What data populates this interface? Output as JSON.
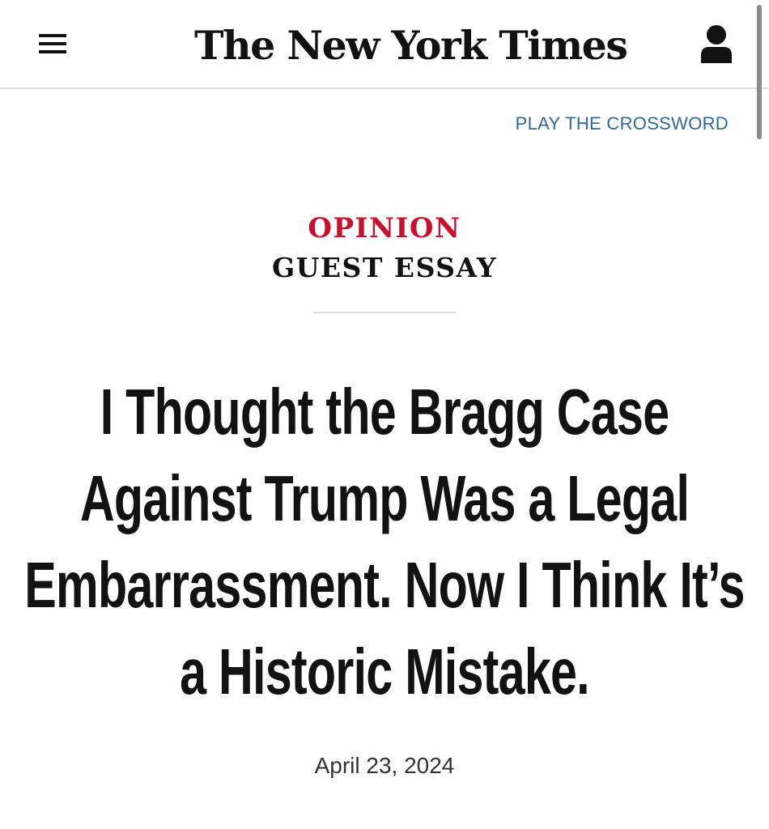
{
  "header": {
    "logo_text": "The New York Times",
    "menu_icon": "hamburger-menu-icon",
    "account_icon": "user-account-icon"
  },
  "crossword_link": "PLAY THE CROSSWORD",
  "article": {
    "section": "OPINION",
    "kicker": "GUEST ESSAY",
    "headline": "I Thought the Bragg Case Against Trump Was a Legal Embarrassment. Now I Think It’s a Historic Mistake.",
    "date": "April 23, 2024"
  },
  "colors": {
    "opinion_red": "#c8102e",
    "link_blue": "#326891",
    "text": "#121212"
  }
}
